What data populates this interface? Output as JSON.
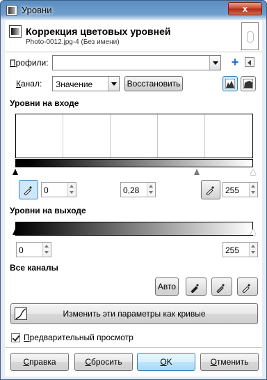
{
  "window": {
    "title": "Уровни",
    "close_label": "x"
  },
  "header": {
    "title": "Коррекция цветовых уровней",
    "subtitle": "Photo-0012.jpg-4 (Без имени)"
  },
  "presets": {
    "label": "Профили:",
    "value": ""
  },
  "channel": {
    "label": "Канал:",
    "value": "Значение",
    "reset_label": "Восстановить"
  },
  "input_levels": {
    "heading": "Уровни на входе",
    "low": "0",
    "gamma": "0,28",
    "high": "255"
  },
  "output_levels": {
    "heading": "Уровни на выходе",
    "low": "0",
    "high": "255"
  },
  "all_channels": {
    "heading": "Все каналы",
    "auto_label": "Авто"
  },
  "edit_curves_label": "Изменить эти параметры как кривые",
  "preview": {
    "label": "Предварительный просмотр",
    "checked": true
  },
  "footer": {
    "help": "Справка",
    "reset": "Сбросить",
    "ok": "OK",
    "cancel": "Отменить"
  }
}
